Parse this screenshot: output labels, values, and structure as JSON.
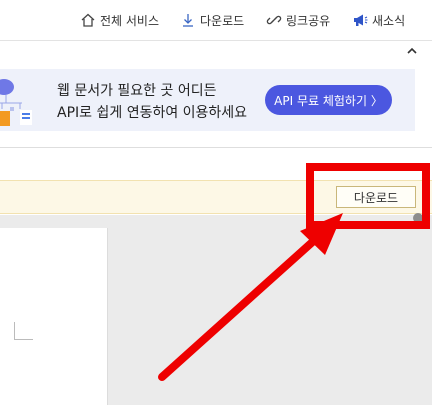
{
  "nav": {
    "all_services": "전체 서비스",
    "download": "다운로드",
    "link_share": "링크공유",
    "news": "새소식"
  },
  "banner": {
    "line1": "웹 문서가 필요한 곳 어디든",
    "line2": "API로 쉽게 연동하여 이용하세요",
    "cta": "API 무료 체험하기 〉"
  },
  "toolbar": {
    "download_label": "다운로드"
  },
  "colors": {
    "accent": "#4b57e0",
    "annotation": "#ee0000",
    "strip": "#fdf8e6"
  },
  "icons": [
    "home-icon",
    "download-icon",
    "link-icon",
    "megaphone-icon",
    "chevron-up-icon"
  ]
}
